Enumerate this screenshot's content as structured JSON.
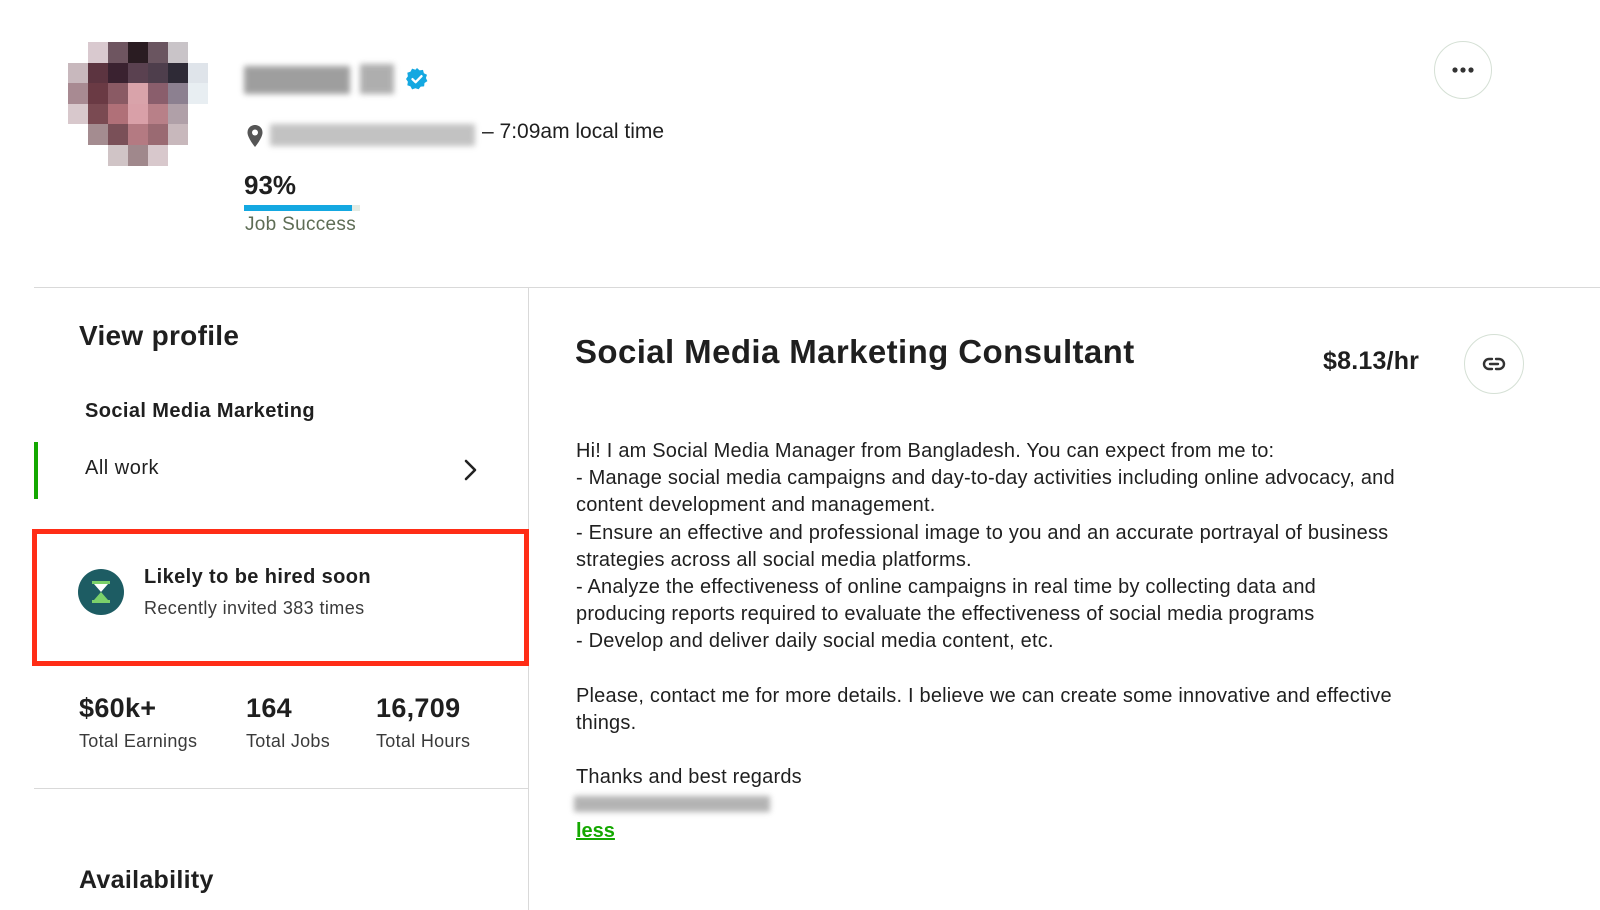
{
  "header": {
    "local_time": "– 7:09am local time",
    "job_success_percent": "93%",
    "job_success_value": 0.93,
    "job_success_label": "Job Success"
  },
  "sidebar": {
    "heading": "View profile",
    "items": [
      {
        "label": "Social Media Marketing",
        "active": false
      },
      {
        "label": "All work",
        "active": true
      }
    ],
    "badge": {
      "title": "Likely to be hired soon",
      "subtitle": "Recently invited 383 times"
    },
    "stats": [
      {
        "value": "$60k+",
        "label": "Total Earnings"
      },
      {
        "value": "164",
        "label": "Total Jobs"
      },
      {
        "value": "16,709",
        "label": "Total Hours"
      }
    ],
    "availability_heading": "Availability"
  },
  "main": {
    "title": "Social Media Marketing Consultant",
    "rate": "$8.13/hr",
    "description": {
      "line1": "Hi! I am Social Media Manager from Bangladesh. You can expect from me to:",
      "line2": "- Manage social media campaigns and day-to-day activities including online advocacy, and",
      "line3": "content development and management.",
      "line4": "- Ensure an effective and professional image to you and an accurate portrayal of business",
      "line5": "strategies across all social media platforms.",
      "line6": "- Analyze the effectiveness of online campaigns in real time by collecting data and",
      "line7": "producing reports required to evaluate the effectiveness of social media programs",
      "line8": "- Develop and deliver daily social media content, etc.",
      "line9": "Please, contact me for more details. I believe we can create some innovative and effective",
      "line10": "things.",
      "line11": "Thanks and best regards"
    },
    "less_link": "less"
  },
  "colors": {
    "accent_green": "#14a800",
    "progress_blue": "#14a8e1",
    "highlight_red": "#ff2d16",
    "badge_teal": "#1d5c63"
  },
  "icons": [
    "verified-badge-icon",
    "location-pin-icon",
    "more-options-icon",
    "chevron-right-icon",
    "hourglass-icon",
    "link-icon"
  ]
}
